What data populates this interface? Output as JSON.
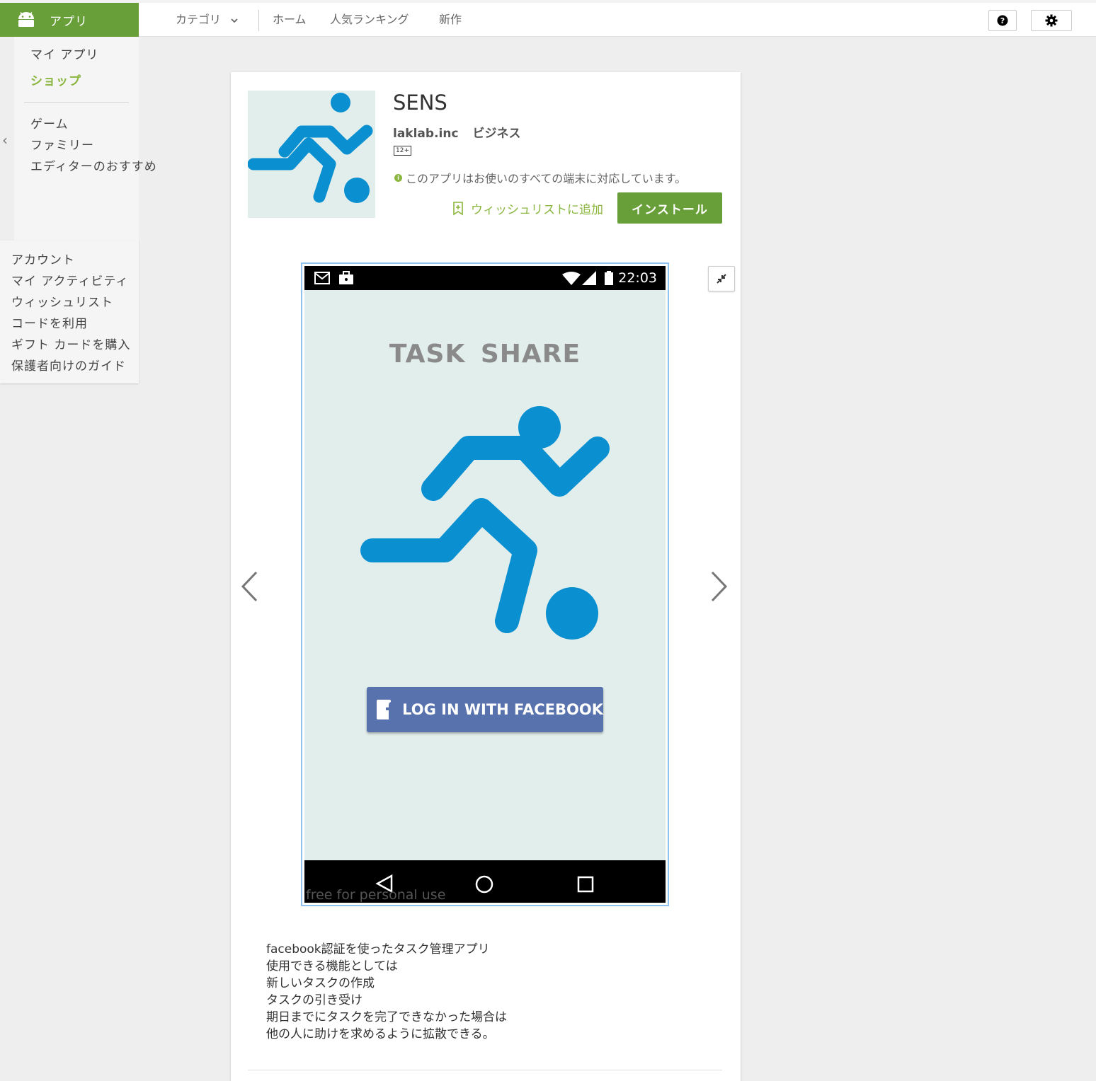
{
  "header": {
    "brand_label": "アプリ",
    "brand_icon": "android-icon",
    "category_label": "カテゴリ",
    "nav": [
      "ホーム",
      "人気ランキング",
      "新作"
    ],
    "help_icon": "help-icon",
    "settings_icon": "gear-icon"
  },
  "sidebar": {
    "top_items": [
      "マイ アプリ",
      "ショップ"
    ],
    "active_item": "ショップ",
    "categories": [
      "ゲーム",
      "ファミリー",
      "エディターのおすすめ"
    ],
    "account_items": [
      "アカウント",
      "マイ アクティビティ",
      "ウィッシュリスト",
      "コードを利用",
      "ギフト カードを購入",
      "保護者向けのガイド"
    ]
  },
  "app": {
    "title": "SENS",
    "developer": "laklab.inc",
    "category": "ビジネス",
    "rating_badge": "12+",
    "compat_text": "このアプリはお使いのすべての端末に対応しています。",
    "wishlist_label": "ウィッシュリストに追加",
    "install_label": "インストール"
  },
  "screenshot": {
    "status_time": "22:03",
    "app_title": "TASK  SHARE",
    "fb_button": "LOG IN WITH FACEBOOK",
    "watermark": "free for personal use"
  },
  "description": [
    "facebook認証を使ったタスク管理アプリ",
    "使用できる機能としては",
    "新しいタスクの作成",
    "タスクの引き受け",
    "期日までにタスクを完了できなかった場合は",
    "他の人に助けを求めるように拡散できる。"
  ],
  "colors": {
    "brand_green": "#689f38",
    "accent_green": "#8ab63f",
    "runner_blue": "#0a8fd0",
    "facebook_blue": "#5872ad"
  }
}
